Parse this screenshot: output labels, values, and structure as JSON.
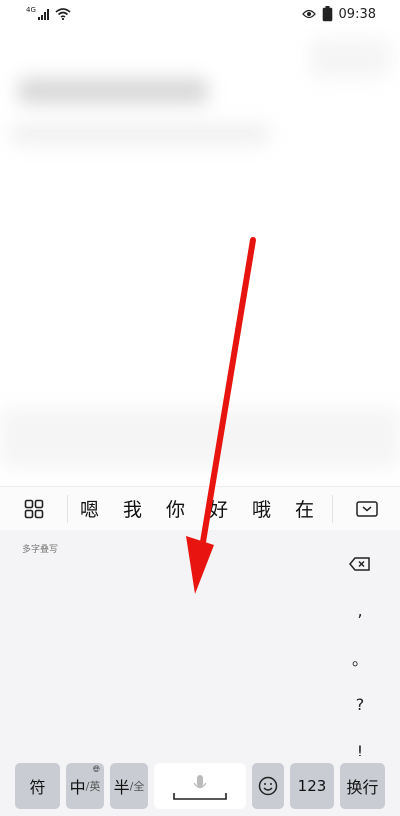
{
  "status_bar": {
    "network_type": "4G",
    "time": "09:38"
  },
  "candidate_bar": {
    "candidates": [
      "嗯",
      "我",
      "你",
      "好",
      "哦",
      "在"
    ]
  },
  "handwriting": {
    "mode_label": "多字叠写",
    "side_keys": [
      ",",
      "。",
      "?",
      "!"
    ]
  },
  "bottom_row": {
    "symbol_label": "符",
    "cn_label": "中",
    "en_label": "/英",
    "half_label": "半",
    "full_label": "/全",
    "numeric_label": "123",
    "enter_label": "换行"
  },
  "colors": {
    "arrow": "#e8140f",
    "key_gray": "#c9ccd3",
    "keyboard_bg": "#f4f4f6"
  }
}
